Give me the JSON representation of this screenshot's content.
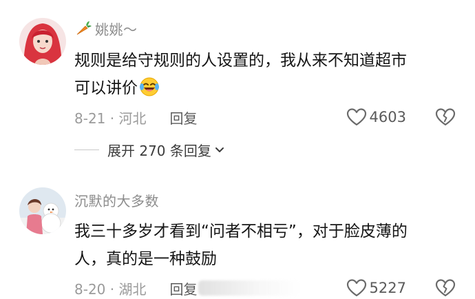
{
  "comments": [
    {
      "username": "姚姚～",
      "username_icon": "carrot-icon",
      "text_lines": [
        "规则是给守规则的人设置的，我从来不知道超市",
        "可以讲价"
      ],
      "text_emoji": "laughing-tears-emoji",
      "date_location": "8-21 · 河北",
      "reply_label": "回复",
      "like_count": "4603",
      "expand_replies": "展开 270 条回复"
    },
    {
      "username": "沉默的大多数",
      "text_lines": [
        "我三十多岁才看到“问者不相亏”，对于脸皮薄的",
        "人，真的是一种鼓励"
      ],
      "date_location": "8-20 · 湖北",
      "reply_label": "回复",
      "like_count": "5227"
    }
  ],
  "colors": {
    "text": "#151515",
    "meta": "#9a9a9a",
    "username": "#8c8c8c",
    "icon": "#6a6a6a"
  }
}
